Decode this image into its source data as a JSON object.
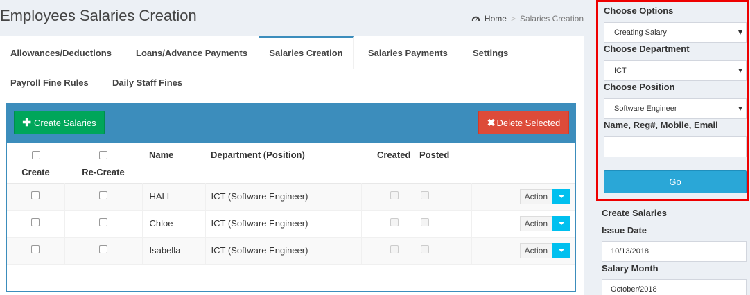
{
  "header": {
    "title": "Employees Salaries Creation",
    "breadcrumb": {
      "home": "Home",
      "sep": ">",
      "current": "Salaries Creation"
    }
  },
  "tabs": [
    {
      "label": "Allowances/Deductions"
    },
    {
      "label": "Loans/Advance Payments"
    },
    {
      "label": "Salaries Creation"
    },
    {
      "label": "Salaries Payments"
    },
    {
      "label": "Settings"
    },
    {
      "label": "Payroll Fine Rules"
    },
    {
      "label": "Daily Staff Fines"
    }
  ],
  "box": {
    "create_label": "Create Salaries",
    "delete_label": "Delete Selected"
  },
  "table": {
    "columns": {
      "create": "Create",
      "recreate": "Re-Create",
      "name": "Name",
      "department": "Department (Position)",
      "created": "Created",
      "posted": "Posted"
    },
    "action_label": "Action",
    "rows": [
      {
        "name": "HALL",
        "department": "ICT (Software Engineer)"
      },
      {
        "name": "Chloe",
        "department": "ICT (Software Engineer)"
      },
      {
        "name": "Isabella",
        "department": "ICT (Software Engineer)"
      }
    ]
  },
  "sidebar": {
    "choose_options_label": "Choose Options",
    "choose_options_value": "Creating Salary",
    "choose_department_label": "Choose Department",
    "choose_department_value": "ICT",
    "choose_position_label": "Choose Position",
    "choose_position_value": "Software Engineer",
    "search_label": "Name, Reg#, Mobile, Email",
    "search_value": "",
    "go_label": "Go",
    "create_salaries_title": "Create Salaries",
    "issue_date_label": "Issue Date",
    "issue_date_value": "10/13/2018",
    "salary_month_label": "Salary Month",
    "salary_month_value": "October/2018"
  },
  "colors": {
    "primary": "#3c8dbc",
    "success": "#00a65a",
    "danger": "#dd4b39",
    "info": "#00c0ef",
    "highlight": "#e00000"
  },
  "icons": {
    "breadcrumb_home": "dashboard-icon",
    "create": "plus-icon",
    "delete": "times-icon",
    "dropdown": "caret-down-icon"
  }
}
